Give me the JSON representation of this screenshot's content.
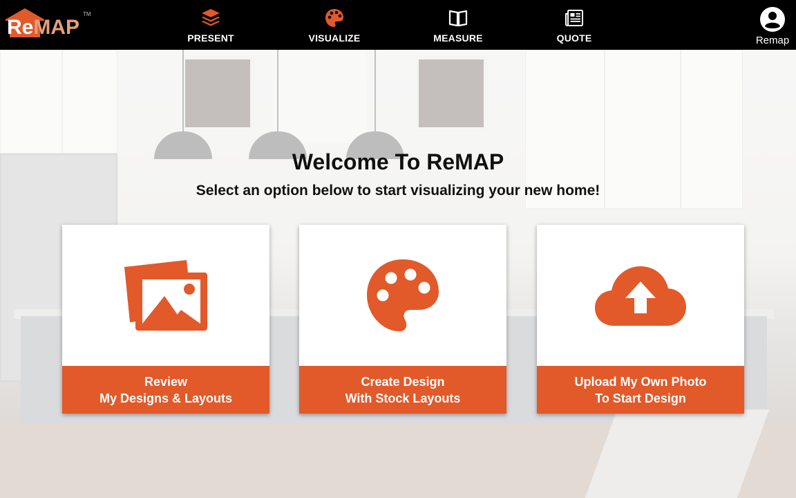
{
  "app": {
    "logo_text_re": "Re",
    "logo_text_map": "MAP",
    "logo_tm": "TM",
    "brand_color": "#e2592a"
  },
  "nav": {
    "items": [
      {
        "label": "PRESENT",
        "icon": "layers-icon"
      },
      {
        "label": "VISUALIZE",
        "icon": "palette-icon",
        "active": true
      },
      {
        "label": "MEASURE",
        "icon": "open-book-icon"
      },
      {
        "label": "QUOTE",
        "icon": "newspaper-icon"
      }
    ],
    "account_label": "Remap",
    "account_icon": "user-avatar-icon"
  },
  "welcome": {
    "title": "Welcome To ReMAP",
    "subtitle": "Select an option below to start visualizing your new home!"
  },
  "cards": [
    {
      "icon": "photos-icon",
      "line1": "Review",
      "line2": "My Designs & Layouts"
    },
    {
      "icon": "palette-icon",
      "line1": "Create Design",
      "line2": "With Stock Layouts"
    },
    {
      "icon": "cloud-upload-icon",
      "line1": "Upload My Own Photo",
      "line2": "To Start Design"
    }
  ],
  "colors": {
    "topbar": "#000000",
    "accent": "#e2592a",
    "active_nav_icon": "#e2592a"
  }
}
